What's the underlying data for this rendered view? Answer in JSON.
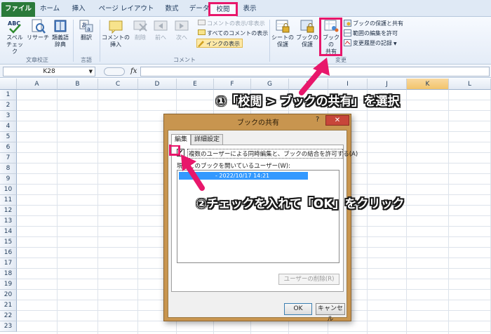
{
  "ribbon": {
    "tabs": [
      {
        "label": "ファイル"
      },
      {
        "label": "ホーム"
      },
      {
        "label": "挿入"
      },
      {
        "label": "ページ レイアウト"
      },
      {
        "label": "数式"
      },
      {
        "label": "データ"
      },
      {
        "label": "校閲"
      },
      {
        "label": "表示"
      }
    ],
    "groups": {
      "proofing": {
        "label": "文章校正",
        "spell": [
          "スペル",
          "チェック"
        ],
        "research": "リサーチ",
        "thesaurus": [
          "類義語",
          "辞典"
        ]
      },
      "language": {
        "label": "言語",
        "translate": "翻訳"
      },
      "comments": {
        "label": "コメント",
        "insert": [
          "コメントの",
          "挿入"
        ],
        "delete": "削除",
        "prev": "前へ",
        "next": "次へ",
        "show_hide": "コメントの表示/非表示",
        "show_all": "すべてのコメントの表示",
        "show_ink": "インクの表示"
      },
      "changes": {
        "label": "変更",
        "protect_sheet": [
          "シートの",
          "保護"
        ],
        "protect_book": [
          "ブックの",
          "保護"
        ],
        "share_book": [
          "ブックの",
          "共有"
        ],
        "protect_share": "ブックの保護と共有",
        "allow_edit": "範囲の編集を許可",
        "track": "変更履歴の記録"
      }
    }
  },
  "formula_bar": {
    "name_box": "K28",
    "fx": "fx"
  },
  "grid": {
    "columns": [
      "A",
      "B",
      "C",
      "D",
      "E",
      "F",
      "G",
      "H",
      "I",
      "J",
      "K",
      "L"
    ],
    "rows": [
      "1",
      "2",
      "3",
      "4",
      "5",
      "6",
      "7",
      "8",
      "9",
      "10",
      "11",
      "12",
      "13",
      "14",
      "15",
      "16",
      "17",
      "18",
      "19",
      "20",
      "21",
      "22",
      "23"
    ],
    "selected_column": "K"
  },
  "dialog": {
    "title": "ブックの共有",
    "help": "?",
    "close": "✕",
    "tabs": [
      "編集",
      "詳細設定"
    ],
    "checkbox_label": "複数のユーザーによる同時編集と、ブックの結合を許可する(A)",
    "checked": true,
    "users_label": "現在このブックを開いているユーザー(W):",
    "user_entry": "- 2022/10/17 14:21",
    "remove_button": "ユーザーの削除(R)",
    "ok": "OK",
    "cancel": "キャンセル"
  },
  "annotations": {
    "step1": "①「校閲 > ブックの共有」を選択",
    "step2": "②チェックを入れて「OK」をクリック",
    "color": "#e8176b"
  }
}
